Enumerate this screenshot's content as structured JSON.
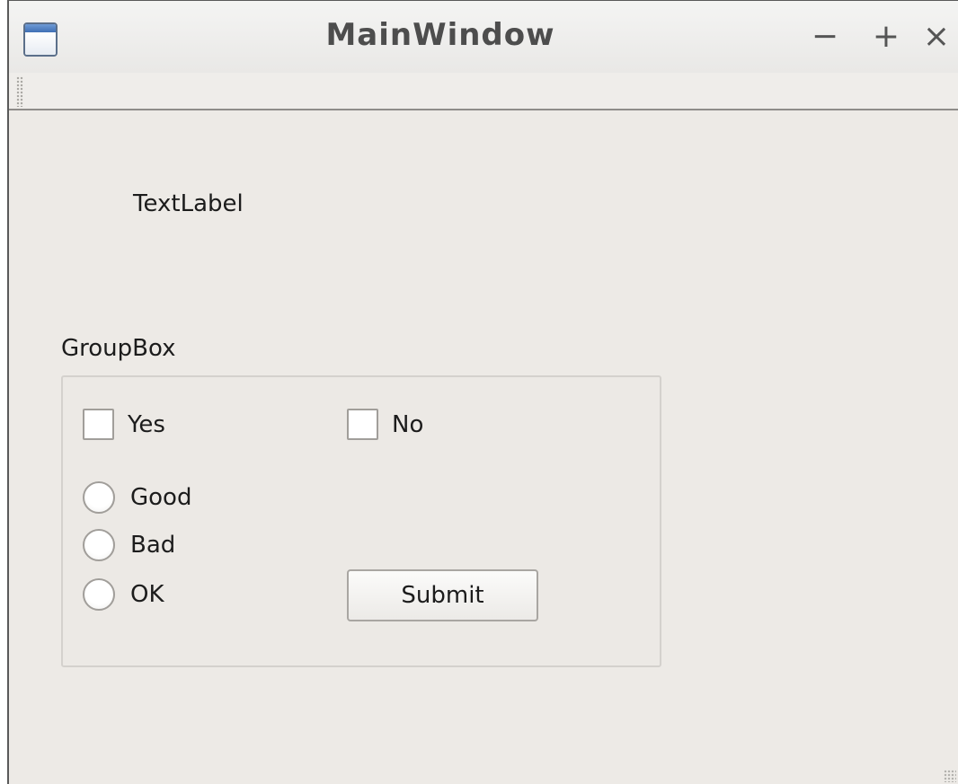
{
  "window": {
    "title": "MainWindow",
    "icon": "app-window-icon",
    "controls": {
      "minimize_label": "−",
      "maximize_label": "+",
      "close_label": "×"
    }
  },
  "central": {
    "text_label": "TextLabel",
    "groupbox": {
      "title": "GroupBox",
      "checkboxes": [
        {
          "label": "Yes",
          "checked": false
        },
        {
          "label": "No",
          "checked": false
        }
      ],
      "radios": [
        {
          "label": "Good",
          "selected": false
        },
        {
          "label": "Bad",
          "selected": false
        },
        {
          "label": "OK",
          "selected": false
        }
      ],
      "submit_label": "Submit"
    }
  },
  "colors": {
    "window_bg": "#edeae6",
    "title_text": "#4d4d4d",
    "icon_accent": "#3f6fb4"
  }
}
